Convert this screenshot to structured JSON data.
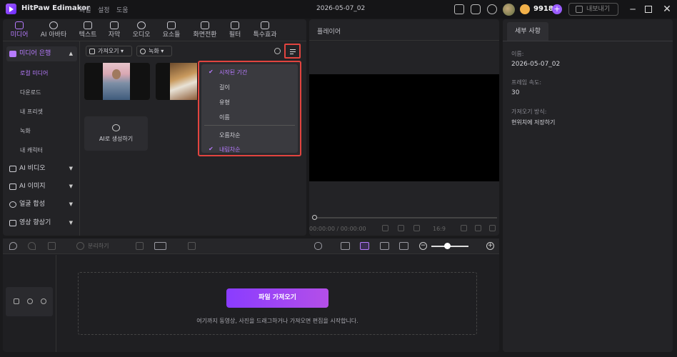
{
  "titlebar": {
    "app_name": "HitPaw Edimakor",
    "menus": [
      "파일",
      "설정",
      "도움"
    ],
    "project_title": "2026-05-07_02",
    "coin_count": "9918",
    "coin_plus": "+",
    "export_label": "내보내기"
  },
  "tabs": [
    {
      "label": "미디어",
      "icon": "media-icon",
      "active": true
    },
    {
      "label": "AI 아바타",
      "icon": "avatar-person-icon"
    },
    {
      "label": "텍스트",
      "icon": "text-icon"
    },
    {
      "label": "자막",
      "icon": "subtitle-icon"
    },
    {
      "label": "오디오",
      "icon": "music-note-icon"
    },
    {
      "label": "요소들",
      "icon": "elements-icon"
    },
    {
      "label": "화면전환",
      "icon": "transition-icon"
    },
    {
      "label": "필터",
      "icon": "filter-icon"
    },
    {
      "label": "특수효과",
      "icon": "effects-icon"
    }
  ],
  "sidebar": {
    "groups": [
      {
        "label": "미디어 은행",
        "expanded": true,
        "active": true
      },
      {
        "label": "AI 비디오"
      },
      {
        "label": "AI  이미지"
      },
      {
        "label": "얼굴 합성"
      },
      {
        "label": "영상 향상기"
      }
    ],
    "items": [
      {
        "label": "로컬 미디어",
        "active": true
      },
      {
        "label": "다운로드"
      },
      {
        "label": "내 프리셋"
      },
      {
        "label": "녹화"
      },
      {
        "label": "내 캐릭터"
      }
    ]
  },
  "media_toolbar": {
    "import_dropdown": "가져오기",
    "record_dropdown": "녹화"
  },
  "ai_generate_label": "AI로 생성하기",
  "sort_menu": {
    "items": [
      "시작된 기간",
      "길이",
      "유형",
      "이름"
    ],
    "order_items": [
      "오름차순",
      "내림차순"
    ],
    "selected_item": "시작된 기간",
    "selected_order": "내림차순"
  },
  "player": {
    "title": "플레이어",
    "timecode": "00:00:00 / 00:00:00",
    "aspect_ratio": "16:9"
  },
  "details": {
    "tab_label": "세부 사항",
    "fields": [
      {
        "label": "이름:",
        "value": "2026-05-07_02"
      },
      {
        "label": "프레임 속도:",
        "value": "30"
      },
      {
        "label": "가져오기 방식:",
        "value": "현위치에 저장하기"
      }
    ]
  },
  "timeline": {
    "split_label": "분리하기",
    "import_button": "파일 가져오기",
    "drop_hint": "여기까지 동영상, 사진을 드래그하거나 가져오면 편집을 시작합니다."
  },
  "colors": {
    "accent": "#b77bff",
    "highlight_box": "#e2443f",
    "button_gradient_start": "#8a3cff",
    "button_gradient_end": "#b44fe8"
  }
}
